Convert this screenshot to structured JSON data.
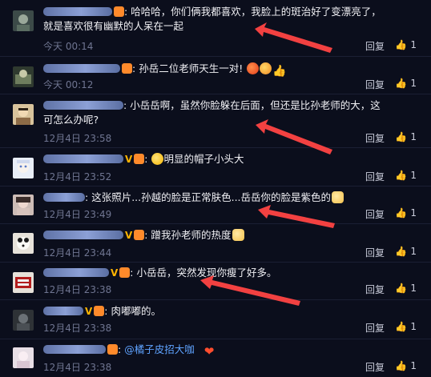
{
  "colors": {
    "accent_arrow": "#f24141",
    "background": "#0b0e1c",
    "mention": "#5fa3ff",
    "verified": "#ffb400"
  },
  "comments": [
    {
      "text": "哈哈哈，你们俩我都喜欢，我脸上的斑治好了变漂亮了，就是喜欢很有幽默的人呆在一起",
      "time": "今天 00:14",
      "reply": "回复",
      "likes": "1"
    },
    {
      "text": "孙岳二位老师天生一对!",
      "time": "今天 00:12",
      "reply": "回复",
      "likes": "1"
    },
    {
      "text": "小岳岳啊，虽然你脸躲在后面，但还是比孙老师的大，这可怎么办呢?",
      "time": "12月4日 23:58",
      "reply": "回复",
      "likes": "1"
    },
    {
      "text": "明显的帽子小头大",
      "time": "12月4日 23:52",
      "reply": "回复",
      "likes": "1"
    },
    {
      "text": "这张照片...孙越的脸是正常肤色...岳岳你的脸是紫色的",
      "time": "12月4日 23:49",
      "reply": "回复",
      "likes": "1"
    },
    {
      "text": "蹭我孙老师的热度",
      "time": "12月4日 23:44",
      "reply": "回复",
      "likes": "1"
    },
    {
      "text": "小岳岳，突然发现你瘦了好多。",
      "time": "12月4日 23:38",
      "reply": "回复",
      "likes": "1"
    },
    {
      "text": "肉嘟嘟的。",
      "time": "12月4日 23:38",
      "reply": "回复",
      "likes": "1"
    },
    {
      "text": "@橘子皮招大咖",
      "time": "12月4日 23:38",
      "reply": "回复",
      "likes": "1"
    }
  ],
  "icons": {
    "thumb": "thumbs-up-icon",
    "laugh": "laughing-emoji-icon",
    "heart": "heart-emoji-icon",
    "cat": "cat-emoji-icon"
  }
}
